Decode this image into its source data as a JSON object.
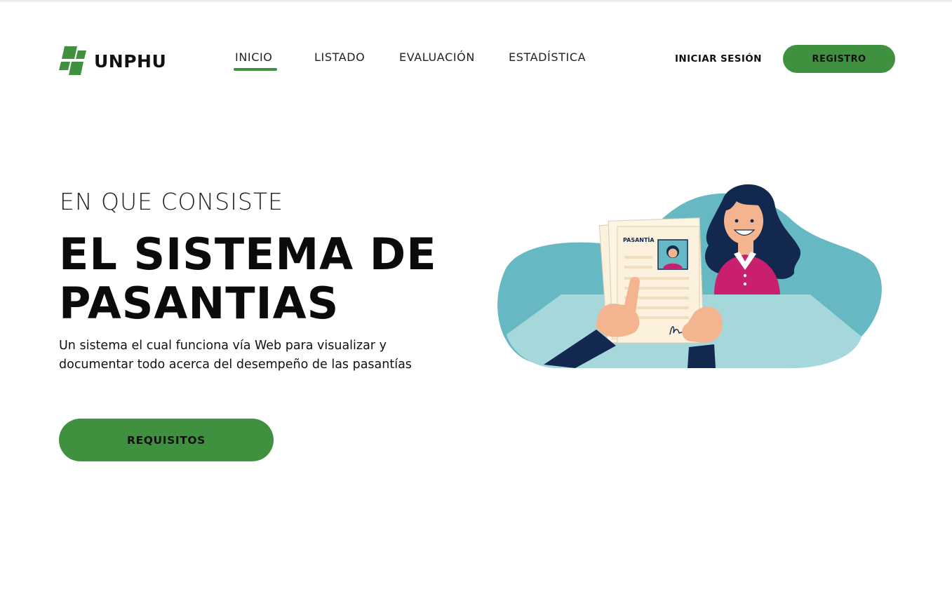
{
  "brand": {
    "name": "UNPHU",
    "logo_icon": "unphu-logo-icon"
  },
  "nav": {
    "items": [
      {
        "label": "INICIO",
        "active": true
      },
      {
        "label": "LISTADO",
        "active": false
      },
      {
        "label": "EVALUACIÓN",
        "active": false
      },
      {
        "label": "ESTADÍSTICA",
        "active": false
      }
    ],
    "login_label": "INICIAR SESIÓN",
    "register_label": "REGISTRO"
  },
  "hero": {
    "eyebrow": "EN QUE CONSISTE",
    "title_line1": "EL SISTEMA DE",
    "title_line2": "PASANTIAS",
    "description": "Un sistema el cual funciona vía Web para visualizar y documentar todo acerca del desempeño de las pasantías",
    "cta_label": "REQUISITOS"
  },
  "illustration": {
    "document_label": "PASANTÍA"
  },
  "colors": {
    "accent": "#3f913f",
    "blob": "#66b9c2",
    "table": "#a6d8db",
    "navy": "#13284f",
    "shirt": "#c81f6e",
    "paper": "#fbf1dc",
    "skin": "#f4b48f"
  }
}
